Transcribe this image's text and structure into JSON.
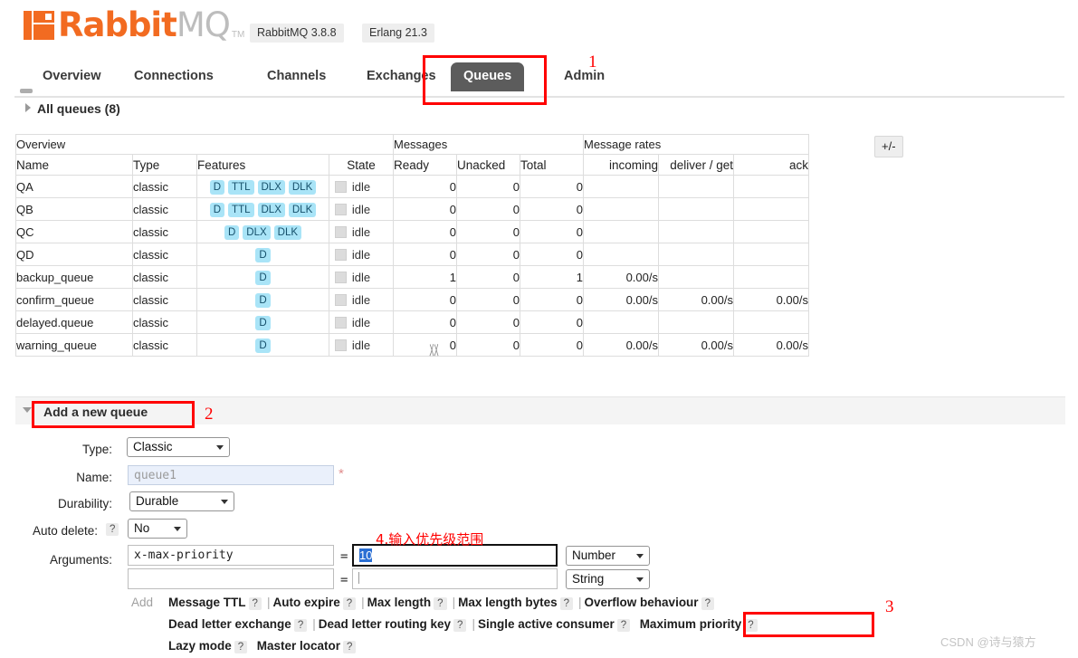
{
  "header": {
    "brand_rabbit": "Rabbit",
    "brand_mq": "MQ",
    "trademark": "TM",
    "rabbitmq_version": "RabbitMQ 3.8.8",
    "erlang_version": "Erlang 21.3"
  },
  "nav": {
    "tabs": [
      {
        "label": "Overview",
        "active": false
      },
      {
        "label": "Connections",
        "active": false
      },
      {
        "label": "Channels",
        "active": false
      },
      {
        "label": "Exchanges",
        "active": false
      },
      {
        "label": "Queues",
        "active": true
      },
      {
        "label": "Admin",
        "active": false
      }
    ]
  },
  "queues_section": {
    "all_queues_label": "All queues (8)",
    "plus_minus_label": "+/-",
    "group_headers": {
      "overview": "Overview",
      "messages": "Messages",
      "message_rates": "Message rates"
    },
    "columns": {
      "name": "Name",
      "type": "Type",
      "features": "Features",
      "state": "State",
      "ready": "Ready",
      "unacked": "Unacked",
      "total": "Total",
      "incoming": "incoming",
      "deliver_get": "deliver / get",
      "ack": "ack"
    },
    "rows": [
      {
        "name": "QA",
        "type": "classic",
        "features": [
          "D",
          "TTL",
          "DLX",
          "DLK"
        ],
        "state": "idle",
        "ready": "0",
        "unacked": "0",
        "total": "0",
        "incoming": "",
        "deliver_get": "",
        "ack": ""
      },
      {
        "name": "QB",
        "type": "classic",
        "features": [
          "D",
          "TTL",
          "DLX",
          "DLK"
        ],
        "state": "idle",
        "ready": "0",
        "unacked": "0",
        "total": "0",
        "incoming": "",
        "deliver_get": "",
        "ack": ""
      },
      {
        "name": "QC",
        "type": "classic",
        "features": [
          "D",
          "DLX",
          "DLK"
        ],
        "state": "idle",
        "ready": "0",
        "unacked": "0",
        "total": "0",
        "incoming": "",
        "deliver_get": "",
        "ack": ""
      },
      {
        "name": "QD",
        "type": "classic",
        "features": [
          "D"
        ],
        "state": "idle",
        "ready": "0",
        "unacked": "0",
        "total": "0",
        "incoming": "",
        "deliver_get": "",
        "ack": ""
      },
      {
        "name": "backup_queue",
        "type": "classic",
        "features": [
          "D"
        ],
        "state": "idle",
        "ready": "1",
        "unacked": "0",
        "total": "1",
        "incoming": "0.00/s",
        "deliver_get": "",
        "ack": ""
      },
      {
        "name": "confirm_queue",
        "type": "classic",
        "features": [
          "D"
        ],
        "state": "idle",
        "ready": "0",
        "unacked": "0",
        "total": "0",
        "incoming": "0.00/s",
        "deliver_get": "0.00/s",
        "ack": "0.00/s"
      },
      {
        "name": "delayed.queue",
        "type": "classic",
        "features": [
          "D"
        ],
        "state": "idle",
        "ready": "0",
        "unacked": "0",
        "total": "0",
        "incoming": "",
        "deliver_get": "",
        "ack": ""
      },
      {
        "name": "warning_queue",
        "type": "classic",
        "features": [
          "D"
        ],
        "state": "idle",
        "ready": "0",
        "unacked": "0",
        "total": "0",
        "incoming": "0.00/s",
        "deliver_get": "0.00/s",
        "ack": "0.00/s"
      }
    ]
  },
  "add_queue_form": {
    "title": "Add a new queue",
    "labels": {
      "type": "Type:",
      "name": "Name:",
      "durability": "Durability:",
      "auto_delete": "Auto delete:",
      "arguments": "Arguments:"
    },
    "type_value": "Classic",
    "name_placeholder": "queue1",
    "name_required_mark": "*",
    "durability_value": "Durable",
    "auto_delete_value": "No",
    "equals_sign": "=",
    "arg_row_1": {
      "key": "x-max-priority",
      "value": "10",
      "type": "Number"
    },
    "arg_row_2": {
      "key": "",
      "value": "",
      "type": "String"
    },
    "add_label": "Add",
    "arg_links_row1": [
      "Message TTL",
      "Auto expire",
      "Max length",
      "Max length bytes",
      "Overflow behaviour"
    ],
    "arg_links_row2": [
      "Dead letter exchange",
      "Dead letter routing key",
      "Single active consumer",
      "Maximum priority"
    ],
    "arg_links_row3": [
      "Lazy mode",
      "Master locator"
    ],
    "help_mark": "?"
  },
  "annotations": {
    "n1": "1",
    "n2": "2",
    "n3": "3",
    "n4_text": "4.输入优先级范围",
    "accent_color": "#ff0000"
  },
  "watermark": "CSDN @诗与猿方"
}
